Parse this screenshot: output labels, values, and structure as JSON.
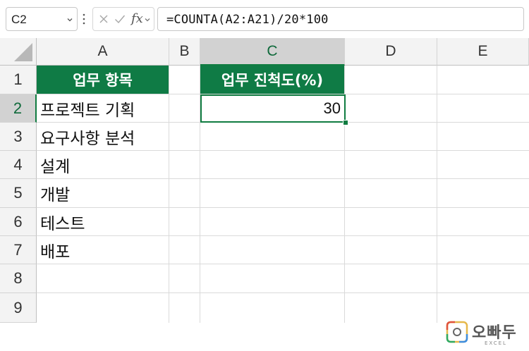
{
  "name_box": {
    "value": "C2"
  },
  "formula_bar": {
    "fx_label": "fx",
    "formula": "=COUNTA(A2:A21)/20*100"
  },
  "columns": [
    "A",
    "B",
    "C",
    "D",
    "E"
  ],
  "rows": [
    "1",
    "2",
    "3",
    "4",
    "5",
    "6",
    "7",
    "8",
    "9"
  ],
  "selected": {
    "column": "C",
    "row": "2"
  },
  "cells": {
    "A1": "업무 항목",
    "A2": "프로젝트 기획",
    "A3": "요구사항 분석",
    "A4": "설계",
    "A5": "개발",
    "A6": "테스트",
    "A7": "배포",
    "C1": "업무 진척도(%)",
    "C2": "30"
  },
  "colors": {
    "header_fill": "#0f7b45",
    "selection": "#107c41"
  },
  "watermark": {
    "brand": "오빠두",
    "sub": "EXCEL"
  }
}
